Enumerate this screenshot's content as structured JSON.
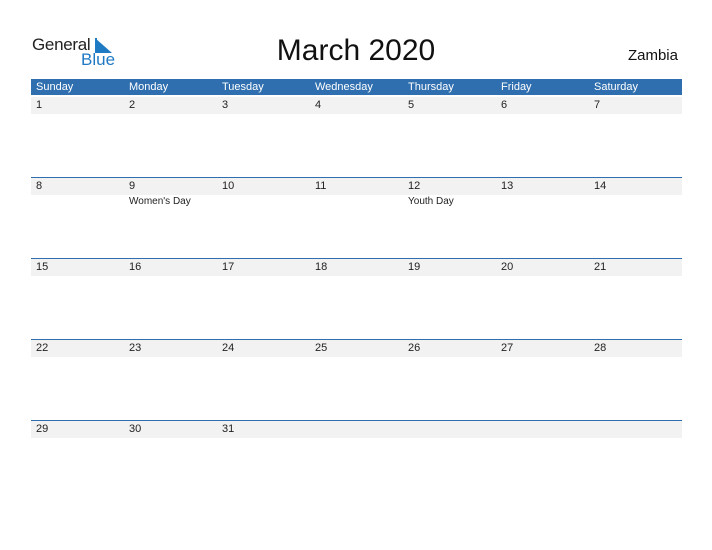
{
  "logo": {
    "line1": "General",
    "line2": "Blue"
  },
  "title": "March 2020",
  "country": "Zambia",
  "colors": {
    "header": "#2f6faf",
    "brand": "#1f7ac4",
    "rowbg": "#f2f2f2"
  },
  "weekdays": [
    "Sunday",
    "Monday",
    "Tuesday",
    "Wednesday",
    "Thursday",
    "Friday",
    "Saturday"
  ],
  "weeks": [
    {
      "days": [
        "1",
        "2",
        "3",
        "4",
        "5",
        "6",
        "7"
      ],
      "events": [
        "",
        "",
        "",
        "",
        "",
        "",
        ""
      ]
    },
    {
      "days": [
        "8",
        "9",
        "10",
        "11",
        "12",
        "13",
        "14"
      ],
      "events": [
        "",
        "Women's Day",
        "",
        "",
        "Youth Day",
        "",
        ""
      ]
    },
    {
      "days": [
        "15",
        "16",
        "17",
        "18",
        "19",
        "20",
        "21"
      ],
      "events": [
        "",
        "",
        "",
        "",
        "",
        "",
        ""
      ]
    },
    {
      "days": [
        "22",
        "23",
        "24",
        "25",
        "26",
        "27",
        "28"
      ],
      "events": [
        "",
        "",
        "",
        "",
        "",
        "",
        ""
      ]
    },
    {
      "days": [
        "29",
        "30",
        "31",
        "",
        "",
        "",
        ""
      ],
      "events": [
        "",
        "",
        "",
        "",
        "",
        "",
        ""
      ]
    }
  ]
}
